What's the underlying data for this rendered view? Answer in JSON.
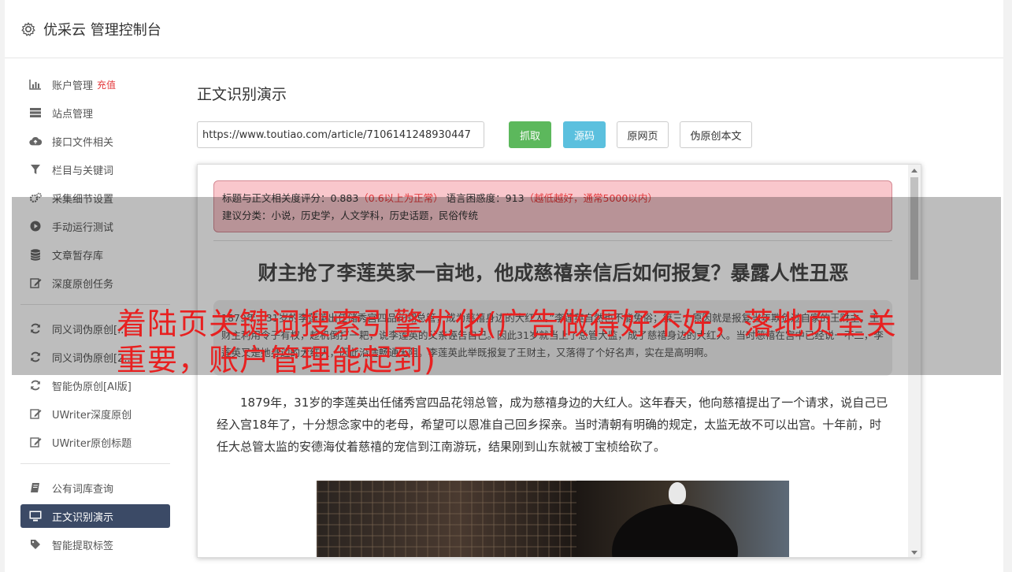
{
  "header": {
    "title": "优采云 管理控制台",
    "icon": "gear-icon"
  },
  "sidebar": {
    "groups": [
      [
        {
          "label": "账户管理",
          "badge": "充值",
          "icon": "bar-chart-icon"
        },
        {
          "label": "站点管理",
          "icon": "server-icon"
        },
        {
          "label": "接口文件相关",
          "icon": "cloud-upload-icon"
        },
        {
          "label": "栏目与关键词",
          "icon": "filter-icon"
        },
        {
          "label": "采集细节设置",
          "icon": "gears-icon"
        },
        {
          "label": "手动运行测试",
          "icon": "play-circle-icon"
        },
        {
          "label": "文章暂存库",
          "icon": "database-icon"
        },
        {
          "label": "深度原创任务",
          "icon": "edit-icon"
        }
      ],
      [
        {
          "label": "同义词伪原创[...",
          "icon": "refresh-icon"
        },
        {
          "label": "同义词伪原创[2...",
          "icon": "refresh-icon"
        },
        {
          "label": "智能伪原创[AI版]",
          "icon": "refresh-icon"
        },
        {
          "label": "UWriter深度原创",
          "icon": "edit-icon"
        },
        {
          "label": "UWriter原创标题",
          "icon": "edit-icon"
        }
      ],
      [
        {
          "label": "公有词库查询",
          "icon": "book-icon"
        },
        {
          "label": "正文识别演示",
          "icon": "monitor-icon",
          "active": true
        },
        {
          "label": "智能提取标签",
          "icon": "tag-icon"
        }
      ]
    ]
  },
  "main": {
    "heading": "正文识别演示",
    "url_value": "https://www.toutiao.com/article/7106141248930447",
    "buttons": {
      "fetch": "抓取",
      "source": "源码",
      "original": "原网页",
      "pseudo": "伪原创本文"
    }
  },
  "result": {
    "score_label": "标题与正文相关度评分：0.883",
    "score_note": "（0.6以上为正常）",
    "perplexity_label": "语言困惑度：913",
    "perplexity_note": "（越低越好，通常5000以内）",
    "category": "建议分类：小说，历史学，人文学科，历史话题，民俗传统",
    "article_title": "财主抢了李莲英家一亩地，他成慈禧亲信后如何报复？暴露人性丑恶",
    "summary": "1879年，31岁的李莲英出任储秀宫四品花翎总管，成为慈禧身边的大红人。”李莲英自然也不能免俗；第三个原因就是报复当年欺负过自家的王财主，王财主利用令子有权，趁机倒打一耙，说李莲英的父亲诬告自己。因此31岁就当上了总管大监，成了慈禧身边的大红人。当时慈禧在宫中已经说一不二，李莲英又是她身边的大红人，因此沿途畅通无阻。李莲英此举既报复了王财主，又落得了个好名声，实在是高明啊。",
    "paragraph": "1879年，31岁的李莲英出任储秀宫四品花翎总管，成为慈禧身边的大红人。这年春天，他向慈禧提出了一个请求，说自己已经入宫18年了，十分想念家中的老母，希望可以恩准自己回乡探亲。当时清朝有明确的规定，太监无故不可以出宫。十年前，时任大总管太监的安德海仗着慈禧的宠信到江南游玩，结果刚到山东就被丁宝桢给砍了。"
  },
  "watermark": "着陆页关键词搜索引擎优化(广告做得好不好，落地页至关重要，账户管理能起到)"
}
